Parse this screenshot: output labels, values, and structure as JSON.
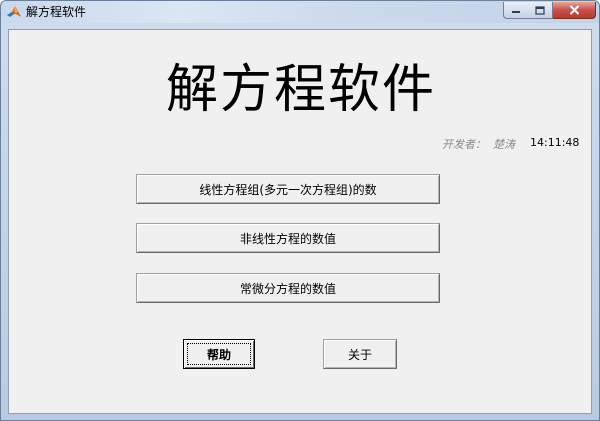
{
  "window": {
    "title": "解方程软件",
    "icon": "matlab-logo-icon",
    "controls": [
      "minimize-icon",
      "maximize-icon",
      "close-icon"
    ]
  },
  "main": {
    "title": "解方程软件",
    "developer_label": "开发者：",
    "developer_name": "楚涛",
    "clock": "14:11:48"
  },
  "buttons": {
    "linear": "线性方程组(多元一次方程组)的数",
    "nonlinear": "非线性方程的数值",
    "ode": "常微分方程的数值",
    "help": "帮助",
    "about": "关于"
  },
  "colors": {
    "client_bg": "#f0f0f0",
    "close_button": "#c75050",
    "developer_text": "#8a8a8a"
  }
}
